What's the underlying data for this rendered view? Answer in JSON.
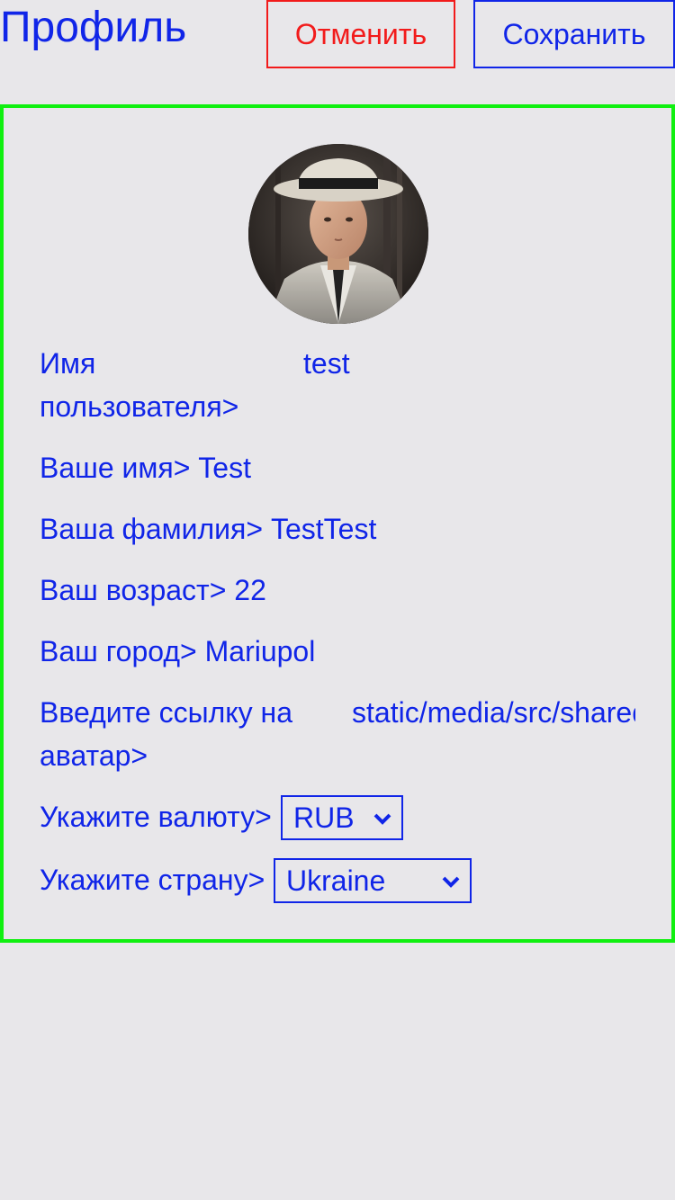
{
  "header": {
    "title": "Профиль",
    "cancel_label": "Отменить",
    "save_label": "Сохранить"
  },
  "profile": {
    "username_label_line1": "Имя",
    "username_label_line2": "пользователя>",
    "username_value": "test",
    "first_name_label": "Ваше имя>",
    "first_name_value": "Test",
    "last_name_label": "Ваша фамилия>",
    "last_name_value": "TestTest",
    "age_label": "Ваш возраст>",
    "age_value": "22",
    "city_label": "Ваш город>",
    "city_value": "Mariupol",
    "avatar_link_label_line1": "Введите ссылку на",
    "avatar_link_label_line2": "аватар>",
    "avatar_link_value": "static/media/src/shared",
    "currency_label": "Укажите валюту>",
    "currency_value": "RUB",
    "country_label": "Укажите страну>",
    "country_value": "Ukraine"
  },
  "colors": {
    "text": "#1025e8",
    "cancel": "#f21b1b",
    "panel_border": "#10f010",
    "background": "#e8e7ea"
  }
}
